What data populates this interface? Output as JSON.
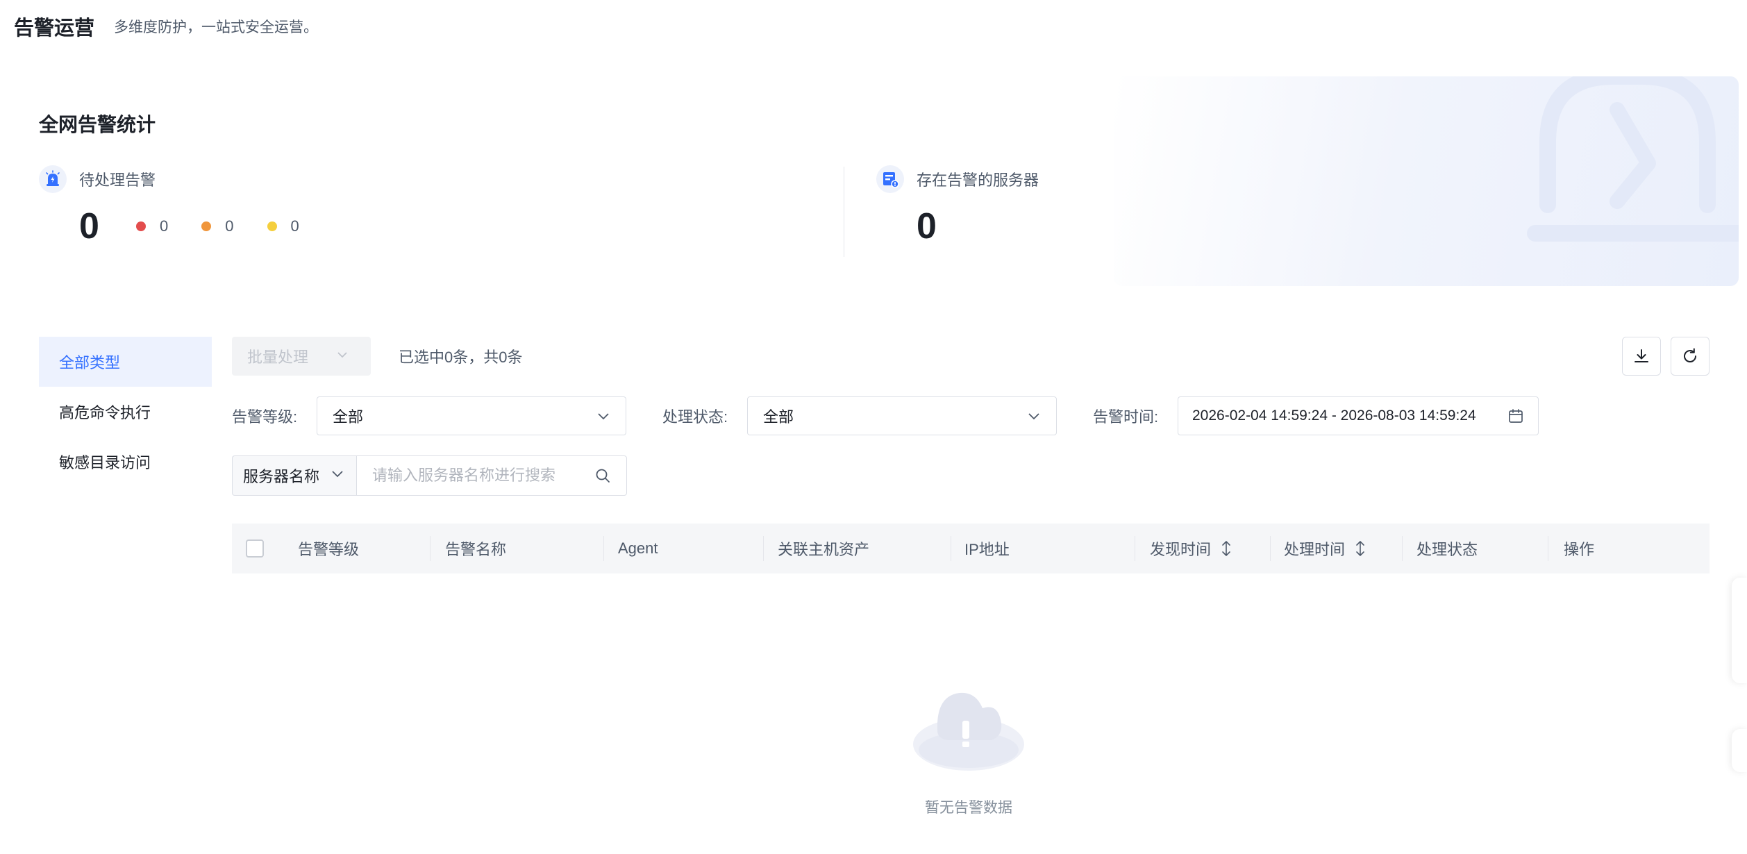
{
  "header": {
    "title": "告警运营",
    "subtitle": "多维度防护，一站式安全运营。"
  },
  "stats": {
    "title": "全网告警统计",
    "pending": {
      "label": "待处理告警",
      "total": "0",
      "levels": [
        {
          "color": "#e34d4d",
          "count": "0"
        },
        {
          "color": "#f0963c",
          "count": "0"
        },
        {
          "color": "#f5cf3d",
          "count": "0"
        }
      ]
    },
    "servers": {
      "label": "存在告警的服务器",
      "total": "0"
    }
  },
  "sidebar": {
    "items": [
      {
        "label": "全部类型",
        "active": true
      },
      {
        "label": "高危命令执行",
        "active": false
      },
      {
        "label": "敏感目录访问",
        "active": false
      }
    ]
  },
  "toolbar": {
    "batch_label": "批量处理",
    "selected_text": "已选中0条，共0条"
  },
  "filters": {
    "level_label": "告警等级:",
    "level_value": "全部",
    "status_label": "处理状态:",
    "status_value": "全部",
    "time_label": "告警时间:",
    "time_value": "2026-02-04 14:59:24 - 2026-08-03 14:59:24"
  },
  "search": {
    "type_label": "服务器名称",
    "placeholder": "请输入服务器名称进行搜索"
  },
  "table": {
    "columns": [
      "告警等级",
      "告警名称",
      "Agent",
      "关联主机资产",
      "IP地址",
      "发现时间",
      "处理时间",
      "处理状态",
      "操作"
    ]
  },
  "empty": {
    "text": "暂无告警数据"
  },
  "colors": {
    "accent": "#3370ff",
    "active_bg": "#edf2fe"
  }
}
